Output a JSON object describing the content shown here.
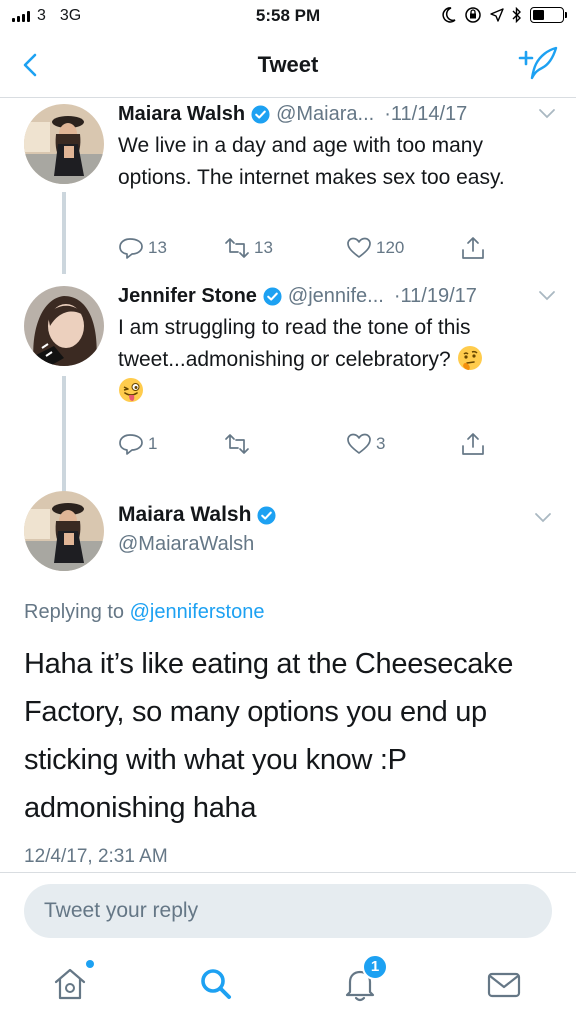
{
  "status_bar": {
    "carrier": "3",
    "network": "3G",
    "time": "5:58 PM",
    "battery_level": 0.4,
    "icons": [
      "moon-icon",
      "lock-rotation-icon",
      "location-icon",
      "bluetooth-icon",
      "battery-icon"
    ]
  },
  "nav": {
    "title": "Tweet",
    "back_icon": "chevron-left-icon",
    "compose_icon": "compose-tweet-icon"
  },
  "thread": [
    {
      "name": "Maiara Walsh",
      "handle": "@Maiara...",
      "separator": "·",
      "date": "11/14/17",
      "text": "We live in a day and age with too many options. The internet makes sex too easy.",
      "replies": "13",
      "retweets": "13",
      "likes": "120"
    },
    {
      "name": "Jennifer Stone",
      "handle": "@jennife...",
      "separator": "·",
      "date": "11/19/17",
      "text": "I am struggling to read the tone of this tweet...admonishing or celebratory?",
      "emojis": [
        "thinking-face-emoji",
        "winking-tongue-emoji"
      ],
      "replies": "1",
      "retweets": "",
      "likes": "3"
    }
  ],
  "focused": {
    "name": "Maiara Walsh",
    "handle": "@MaiaraWalsh",
    "replying_prefix": "Replying to",
    "replying_to": "@jenniferstone",
    "text": "Haha it’s like eating at the Cheesecake Factory, so many options you end up sticking with what you know :P admonishing haha",
    "timestamp": "12/4/17, 2:31 AM"
  },
  "reply": {
    "placeholder": "Tweet your reply"
  },
  "tabs": {
    "home_icon": "home-icon",
    "search_icon": "search-icon",
    "notifications_icon": "bell-icon",
    "notifications_badge": "1",
    "messages_icon": "mail-icon"
  },
  "colors": {
    "accent": "#1da1f2",
    "secondary_text": "#657786",
    "thread_line": "#ccd6dd"
  }
}
